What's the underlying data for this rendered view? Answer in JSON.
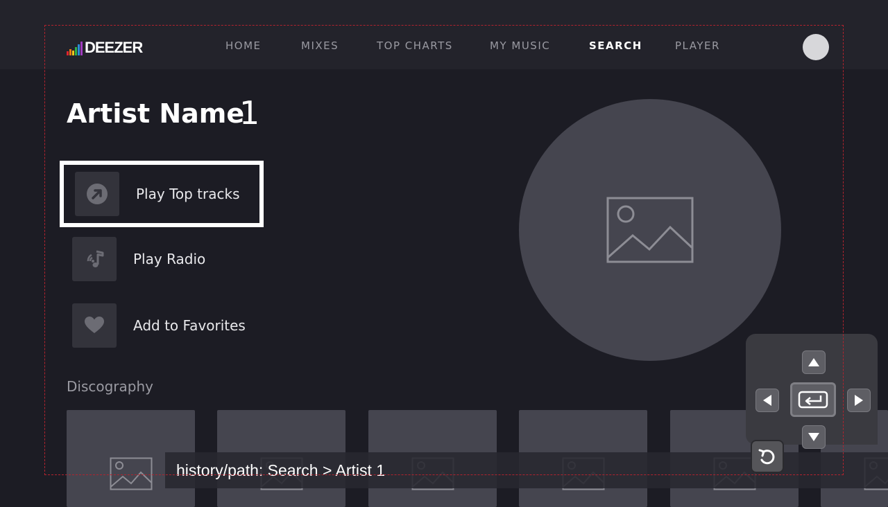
{
  "app": {
    "logo_text": "DEEZER"
  },
  "nav": {
    "items": [
      {
        "label": "HOME"
      },
      {
        "label": "MIXES"
      },
      {
        "label": "TOP CHARTS"
      },
      {
        "label": "MY MUSIC"
      },
      {
        "label": "SEARCH",
        "active": true
      },
      {
        "label": "PLAYER"
      }
    ]
  },
  "artist": {
    "name": "Artist Name",
    "number": "1"
  },
  "actions": [
    {
      "label": "Play Top tracks",
      "icon": "arrow-up-right-circle-icon",
      "focused": true
    },
    {
      "label": "Play Radio",
      "icon": "radio-music-note-icon"
    },
    {
      "label": "Add to Favorites",
      "icon": "heart-icon"
    }
  ],
  "discography": {
    "title": "Discography",
    "album_count": 6
  },
  "history": {
    "text": "history/path: Search > Artist 1"
  },
  "remote": {
    "buttons": [
      "up-arrow-icon",
      "left-arrow-icon",
      "enter-icon",
      "right-arrow-icon",
      "down-arrow-icon",
      "back-icon"
    ]
  },
  "colors": {
    "background": "#1c1c24",
    "topbar": "#23232b",
    "placeholder": "#45454f",
    "focus_border": "#ffffff",
    "safe_area": "#b3232e"
  }
}
